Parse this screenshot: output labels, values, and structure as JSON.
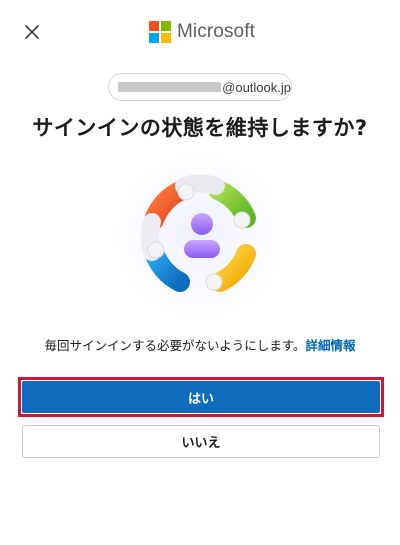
{
  "header": {
    "close_icon": "close-icon",
    "brand_name": "Microsoft",
    "brand_colors": [
      "#f25022",
      "#7fba00",
      "#00a4ef",
      "#ffb900"
    ]
  },
  "account": {
    "masked_username": "",
    "domain": "@outlook.jp"
  },
  "title": "サインインの状態を維持しますか?",
  "illustration_icon": "people-circle-icon",
  "description": {
    "text": "毎回サインインする必要がないようにします。",
    "link": "詳細情報"
  },
  "buttons": {
    "yes_label": "はい",
    "no_label": "いいえ"
  },
  "colors": {
    "primary": "#0f6cbd",
    "focus_ring": "#d2143a",
    "link": "#0067b8"
  }
}
